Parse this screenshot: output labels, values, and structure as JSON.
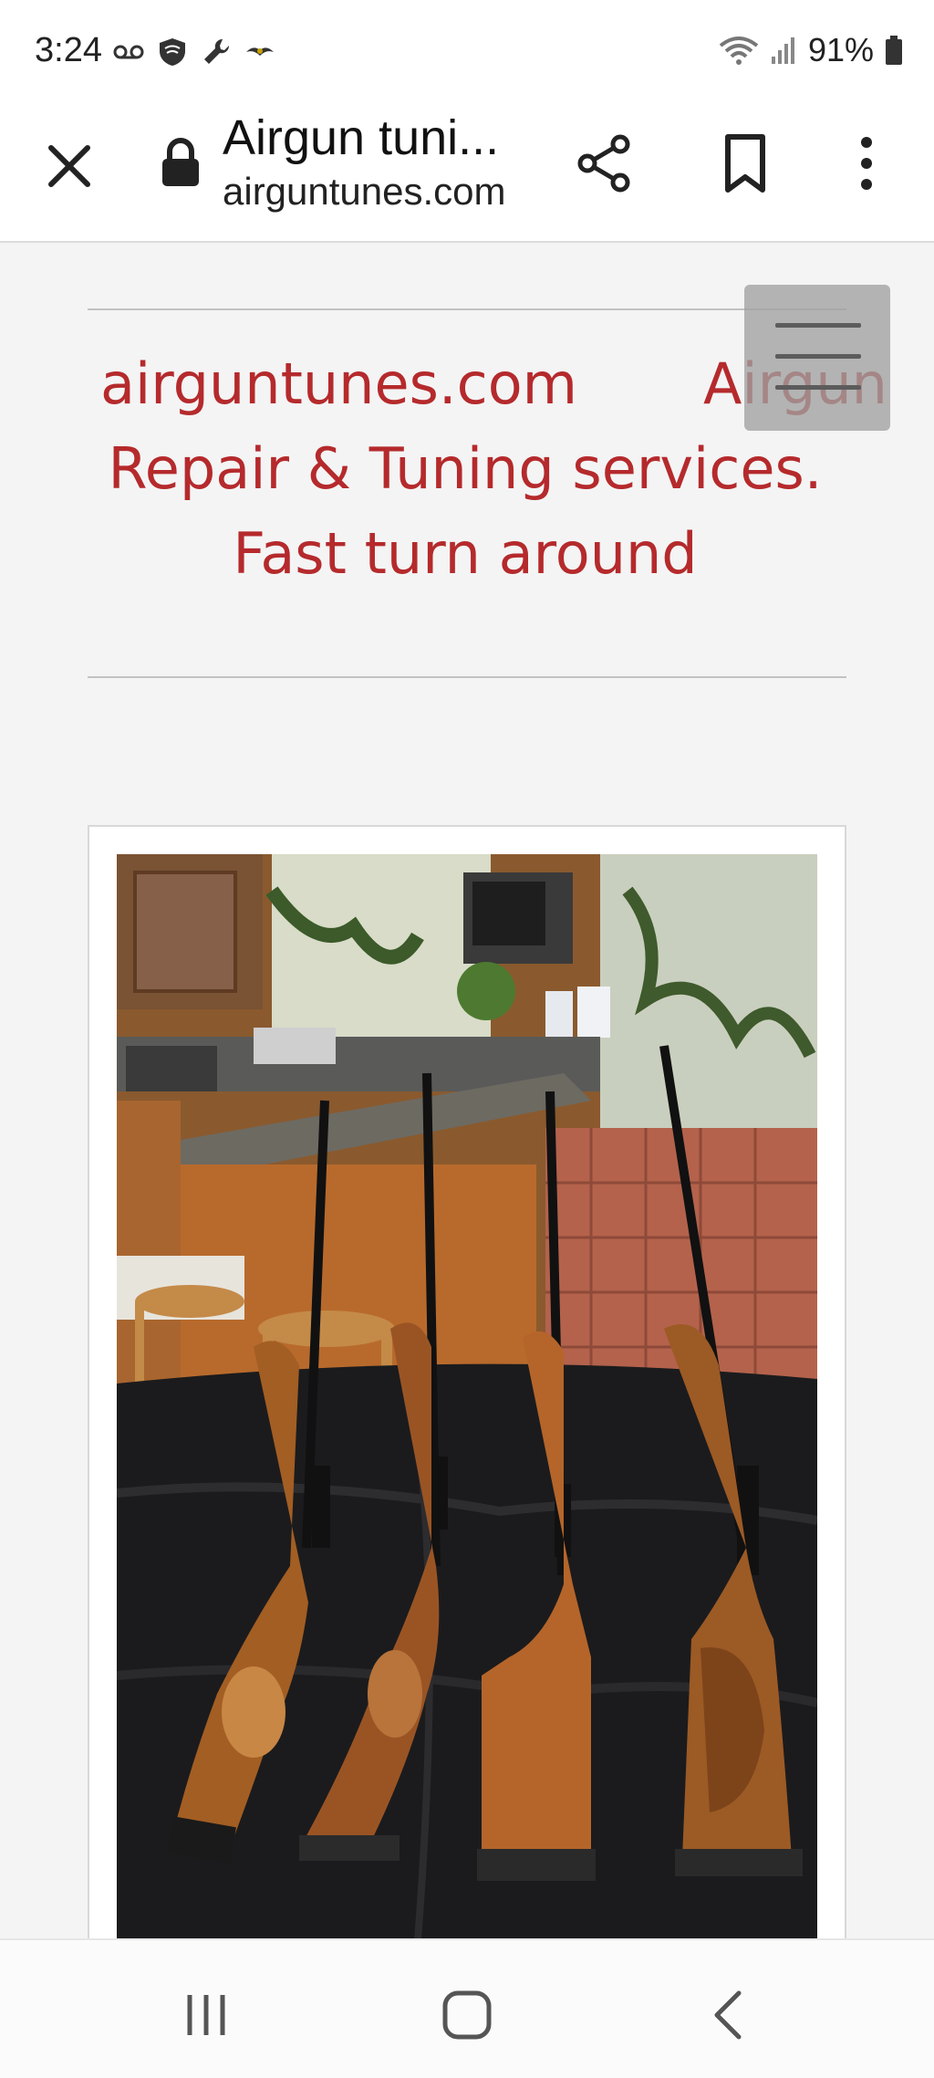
{
  "status_bar": {
    "time": "3:24",
    "battery": "91%",
    "left_icons": [
      "voicemail-icon",
      "shield-icon",
      "wrench-icon",
      "bird-icon"
    ],
    "right_icons": [
      "wifi-icon",
      "signal-icon",
      "battery-icon"
    ]
  },
  "browser": {
    "page_title": "Airgun tuni...",
    "domain": "airguntunes.com",
    "icons": [
      "close-icon",
      "lock-icon",
      "share-icon",
      "bookmark-icon",
      "more-vert-icon"
    ]
  },
  "page": {
    "hero_lines": [
      "airguntunes.com       Airgun",
      "Repair & Tuning services.",
      "Fast turn around"
    ],
    "accent_color": "#b52a2c",
    "photo_alt_icon": "rifles-photo"
  },
  "navbar": {
    "icons": [
      "recent-apps-icon",
      "home-icon",
      "back-icon"
    ]
  }
}
